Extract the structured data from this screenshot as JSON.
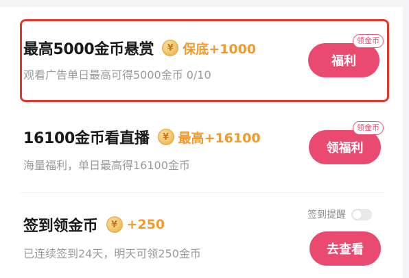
{
  "tasks": [
    {
      "title": "最高5000金币悬赏",
      "coin_symbol": "¥",
      "reward": "保底+1000",
      "subtitle": "观看广告单日最高可得5000金币 0/10",
      "button_label": "福利",
      "badge": "领金币",
      "highlighted": true
    },
    {
      "title": "16100金币看直播",
      "coin_symbol": "¥",
      "reward": "最高+16100",
      "subtitle": "海量福利，单日最高得16100金币",
      "button_label": "领福利",
      "badge": "领金币"
    },
    {
      "title": "签到领金币",
      "coin_symbol": "¥",
      "reward": "+250",
      "subtitle": "已连续签到24天，明天可领250金币",
      "button_label": "去查看",
      "reminder": {
        "label": "签到提醒",
        "enabled": false
      }
    }
  ],
  "colors": {
    "accent": "#ea4a6f",
    "reward": "#f39a2b",
    "highlight_border": "#e8352a"
  }
}
